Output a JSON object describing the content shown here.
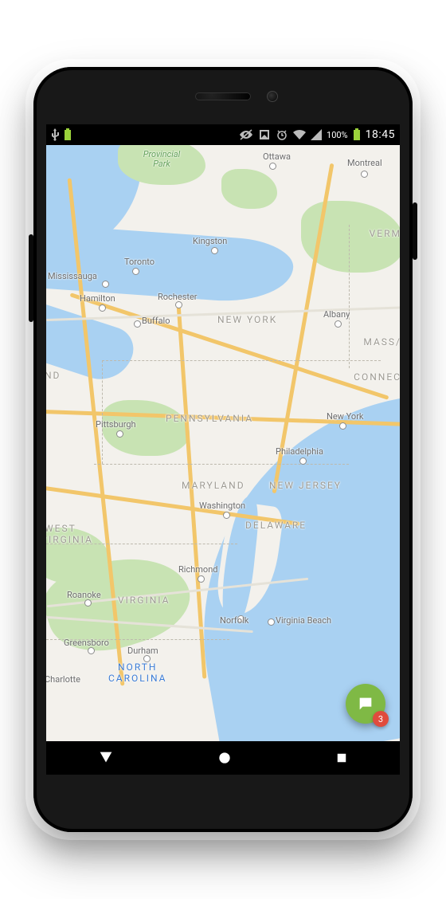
{
  "status_bar": {
    "battery_pct": "100%",
    "clock": "18:45"
  },
  "map": {
    "park_label": "Provincial Park",
    "states": {
      "new_york": "NEW YORK",
      "pennsylvania": "PENNSYLVANIA",
      "maryland": "MARYLAND",
      "new_jersey": "NEW JERSEY",
      "delaware": "DELAWARE",
      "virginia": "VIRGINIA",
      "west_virginia_1": "WEST",
      "west_virginia_2": "/IRGINIA",
      "north_carolina_1": "NORTH",
      "north_carolina_2": "CAROLINA",
      "vermont": "VERM",
      "massachusetts": "MASS/",
      "connecticut": "CONNEC",
      "nd_cut": "ND"
    },
    "cities": {
      "ottawa": "Ottawa",
      "montreal": "Montreal",
      "kingston": "Kingston",
      "toronto": "Toronto",
      "mississauga": "Mississauga",
      "hamilton": "Hamilton",
      "rochester": "Rochester",
      "buffalo": "Buffalo",
      "albany": "Albany",
      "new_york": "New York",
      "philadelphia": "Philadelphia",
      "washington": "Washington",
      "pittsburgh": "Pittsburgh",
      "richmond": "Richmond",
      "roanoke": "Roanoke",
      "norfolk": "Norfolk",
      "virginia_beach": "Virginia Beach",
      "greensboro": "Greensboro",
      "durham": "Durham",
      "charlotte": "Charlotte"
    }
  },
  "fab": {
    "badge_count": "3"
  }
}
